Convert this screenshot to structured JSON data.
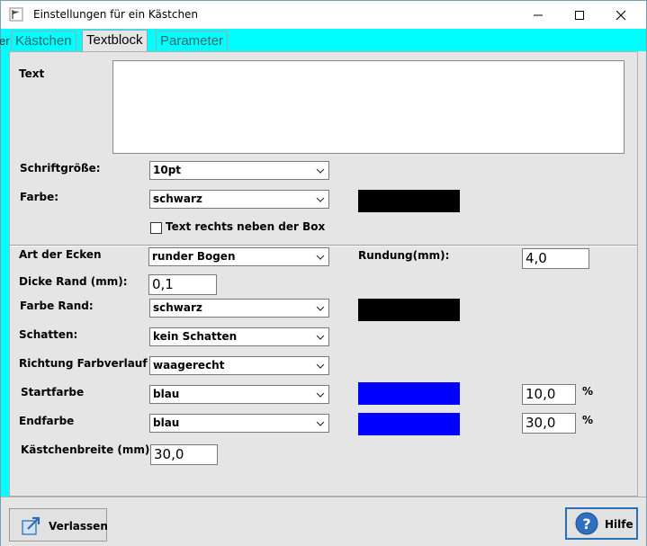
{
  "window": {
    "title": "Einstellungen für ein Kästchen",
    "controls": {
      "minimize": "minimize",
      "maximize": "maximize",
      "close": "close"
    }
  },
  "background": {
    "left_text": "er"
  },
  "tabs": [
    {
      "label": "Kästchen",
      "active": false
    },
    {
      "label": "Textblock",
      "active": true
    },
    {
      "label": "Parameter",
      "active": false
    }
  ],
  "form": {
    "text": {
      "label": "Text",
      "value": ""
    },
    "font_size": {
      "label": "Schriftgröße:",
      "value": "10pt"
    },
    "color": {
      "label": "Farbe:",
      "value": "schwarz",
      "swatch": "#000000"
    },
    "text_right": {
      "label": "Text rechts neben der Box",
      "checked": false
    },
    "corners": {
      "label": "Art der Ecken",
      "value": "runder Bogen"
    },
    "rounding": {
      "label": "Rundung(mm):",
      "value": "4,0"
    },
    "border_thickness": {
      "label": "Dicke Rand (mm):",
      "value": "0,1"
    },
    "border_color": {
      "label": "Farbe Rand:",
      "value": "schwarz",
      "swatch": "#000000"
    },
    "shadow": {
      "label": "Schatten:",
      "value": "kein Schatten"
    },
    "gradient_direction": {
      "label": "Richtung Farbverlauf",
      "value": "waagerecht"
    },
    "start_color": {
      "label": "Startfarbe",
      "value": "blau",
      "swatch": "#0000ff",
      "percent": "10,0",
      "unit": "%"
    },
    "end_color": {
      "label": "Endfarbe",
      "value": "blau",
      "swatch": "#0000ff",
      "percent": "30,0",
      "unit": "%"
    },
    "box_width": {
      "label": "Kästchenbreite (mm):",
      "value": "30,0"
    }
  },
  "footer": {
    "leave_label": "Verlassen",
    "help_label": "Hilfe"
  }
}
